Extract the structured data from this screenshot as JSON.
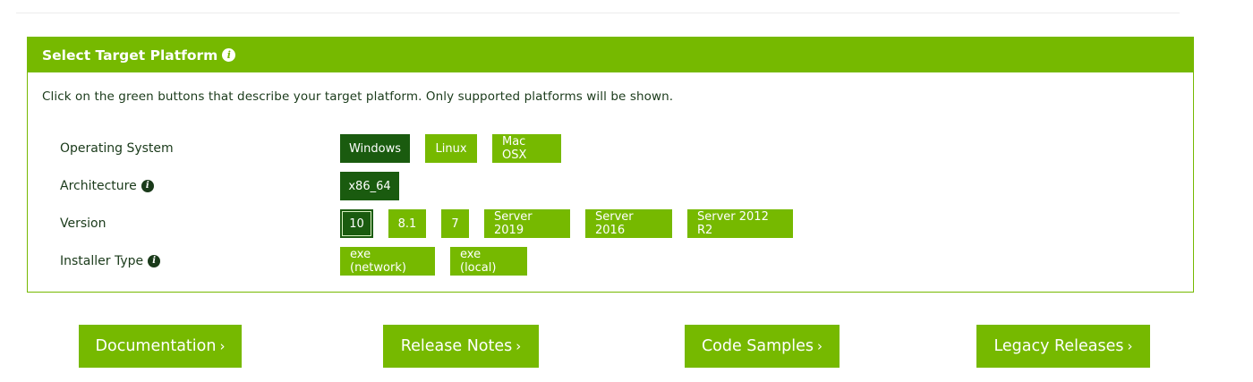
{
  "panel": {
    "title": "Select Target Platform",
    "instructions": "Click on the green buttons that describe your target platform. Only supported platforms will be shown."
  },
  "rows": {
    "os": {
      "label": "Operating System",
      "options": [
        "Windows",
        "Linux",
        "Mac OSX"
      ],
      "selected": "Windows"
    },
    "arch": {
      "label": "Architecture",
      "options": [
        "x86_64"
      ],
      "selected": "x86_64"
    },
    "version": {
      "label": "Version",
      "options": [
        "10",
        "8.1",
        "7",
        "Server 2019",
        "Server 2016",
        "Server 2012 R2"
      ],
      "selected": "10"
    },
    "installer": {
      "label": "Installer Type",
      "options": [
        "exe (network)",
        "exe (local)"
      ]
    }
  },
  "links": {
    "documentation": "Documentation",
    "release_notes": "Release Notes",
    "code_samples": "Code Samples",
    "legacy_releases": "Legacy Releases",
    "chevron": "›"
  },
  "icons": {
    "info": "i"
  },
  "colors": {
    "accent": "#76b900",
    "selected": "#1a5b0f",
    "text": "#1a3a1a"
  }
}
